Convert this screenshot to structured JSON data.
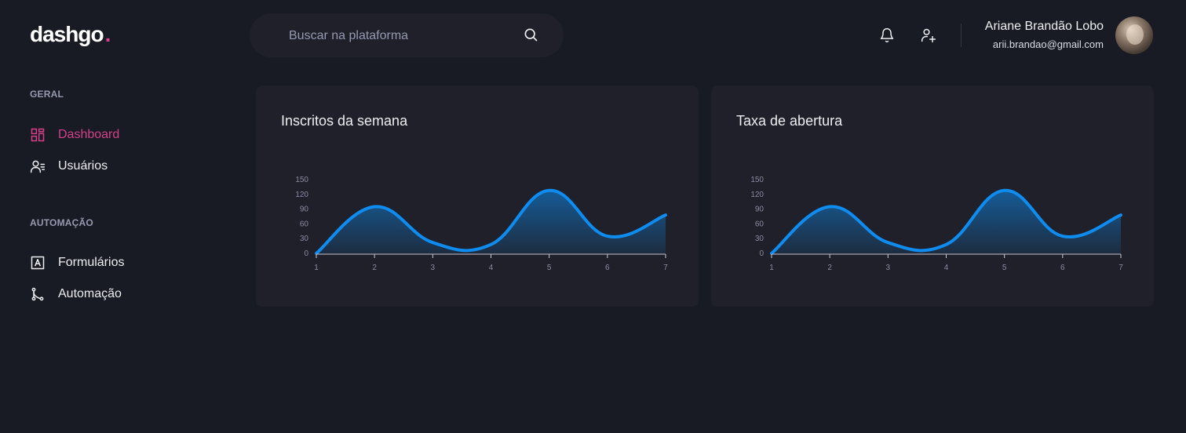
{
  "header": {
    "logo_text": "dashgo",
    "logo_dot": ".",
    "search_placeholder": "Buscar na plataforma",
    "user": {
      "name": "Ariane Brandão Lobo",
      "email": "arii.brandao@gmail.com"
    }
  },
  "colors": {
    "background": "#181b23",
    "card": "#1f2029",
    "accent": "#d53f8c",
    "series": "#0e8cf0",
    "muted": "#9699b0"
  },
  "sidebar": {
    "sections": [
      {
        "title": "GERAL",
        "items": [
          {
            "label": "Dashboard",
            "icon": "dashboard-icon",
            "active": true
          },
          {
            "label": "Usuários",
            "icon": "users-icon",
            "active": false
          }
        ]
      },
      {
        "title": "AUTOMAÇÃO",
        "items": [
          {
            "label": "Formulários",
            "icon": "form-icon",
            "active": false
          },
          {
            "label": "Automação",
            "icon": "git-merge-icon",
            "active": false
          }
        ]
      }
    ]
  },
  "cards": [
    {
      "title": "Inscritos da semana"
    },
    {
      "title": "Taxa de abertura"
    }
  ],
  "chart_data": [
    {
      "type": "area",
      "title": "Inscritos da semana",
      "x": [
        1,
        2,
        3,
        4,
        5,
        6,
        7
      ],
      "values": [
        0,
        95,
        22,
        18,
        128,
        35,
        78
      ],
      "yticks": [
        0,
        30,
        60,
        90,
        120,
        150
      ],
      "ylim": [
        0,
        150
      ],
      "xlim": [
        1,
        7
      ],
      "grid": false,
      "legend": "none"
    },
    {
      "type": "area",
      "title": "Taxa de abertura",
      "x": [
        1,
        2,
        3,
        4,
        5,
        6,
        7
      ],
      "values": [
        0,
        95,
        22,
        18,
        128,
        35,
        78
      ],
      "yticks": [
        0,
        30,
        60,
        90,
        120,
        150
      ],
      "ylim": [
        0,
        150
      ],
      "xlim": [
        1,
        7
      ],
      "grid": false,
      "legend": "none"
    }
  ]
}
